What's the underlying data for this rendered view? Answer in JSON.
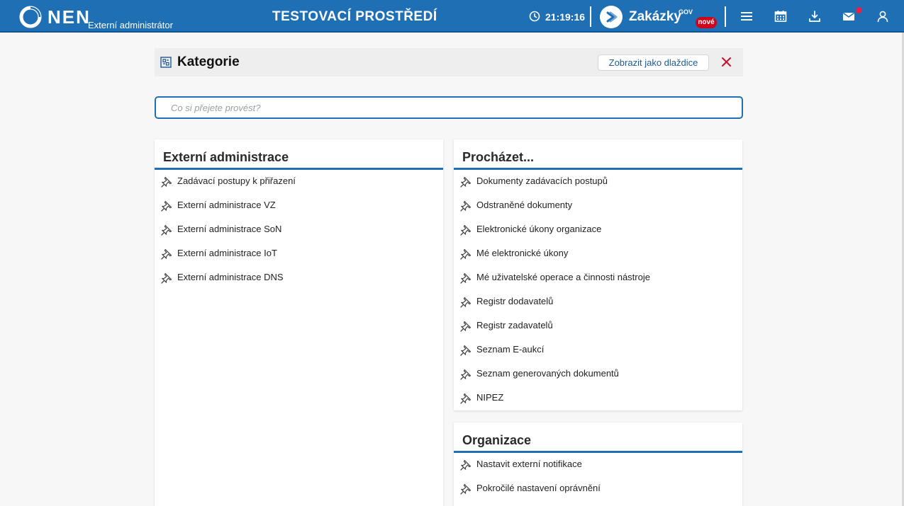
{
  "header": {
    "brand": "NEN",
    "role": "Externí administrátor",
    "environment": "TESTOVACÍ PROSTŘEDÍ",
    "time": "21:19:16",
    "zakazky": {
      "name": "Zakázky",
      "sup": "GOV",
      "badge": "nové"
    },
    "icons": [
      "menu-icon",
      "calendar-icon",
      "download-icon",
      "mail-icon",
      "user-icon"
    ],
    "accent_color": "#1f6fb5",
    "notification_color": "#e0244a"
  },
  "page": {
    "title": "Kategorie",
    "tiles_button": "Zobrazit jako dlaždice",
    "search_placeholder": "Co si přejete provést?"
  },
  "sections": {
    "ext_admin": {
      "title": "Externí administrace",
      "items": [
        "Zadávací postupy k přiřazení",
        "Externí administrace VZ",
        "Externí administrace SoN",
        "Externí administrace IoT",
        "Externí administrace DNS"
      ]
    },
    "browse": {
      "title": "Procházet...",
      "items": [
        "Dokumenty zadávacích postupů",
        "Odstraněné dokumenty",
        "Elektronické úkony organizace",
        "Mé elektronické úkony",
        "Mé uživatelské operace a činnosti nástroje",
        "Registr dodavatelů",
        "Registr zadavatelů",
        "Seznam E-aukcí",
        "Seznam generovaných dokumentů",
        "NIPEZ"
      ]
    },
    "organization": {
      "title": "Organizace",
      "items": [
        "Nastavit externí notifikace",
        "Pokročilé nastavení oprávnění"
      ]
    }
  }
}
